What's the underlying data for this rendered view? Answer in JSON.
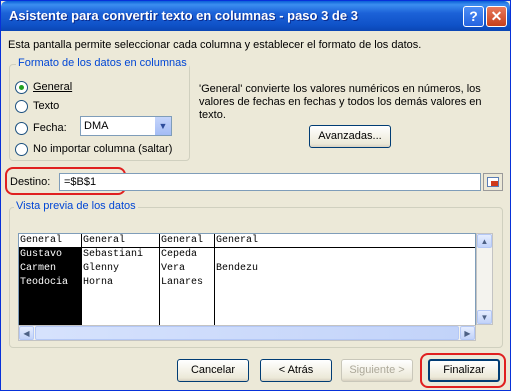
{
  "window": {
    "title": "Asistente para convertir texto en columnas - paso 3 de 3",
    "help_label": "?",
    "close_label": "✕"
  },
  "description": "Esta pantalla permite seleccionar cada columna y establecer el formato de los datos.",
  "format_group": {
    "legend": "Formato de los datos en columnas",
    "options": [
      {
        "label": "General",
        "checked": true
      },
      {
        "label": "Texto",
        "checked": false
      },
      {
        "label": "Fecha:",
        "checked": false
      },
      {
        "label": "No importar columna (saltar)",
        "checked": false
      }
    ],
    "date_select": {
      "value": "DMA"
    }
  },
  "info_text": "'General' convierte los valores numéricos en números, los valores de fechas en fechas y todos los demás valores en texto.",
  "advanced_button": "Avanzadas...",
  "destination": {
    "label": "Destino:",
    "value": "=$B$1"
  },
  "preview": {
    "legend": "Vista previa de los datos",
    "columns": [
      {
        "header": "General",
        "cells": [
          "Gustavo",
          "Carmen",
          "Teodocia"
        ],
        "selected": true
      },
      {
        "header": "General",
        "cells": [
          "Sebastiani",
          "Glenny",
          "Horna"
        ],
        "selected": false
      },
      {
        "header": "General",
        "cells": [
          "Cepeda",
          "Vera",
          "Lanares"
        ],
        "selected": false
      },
      {
        "header": "General",
        "cells": [
          "",
          "Bendezu",
          ""
        ],
        "selected": false
      }
    ]
  },
  "buttons": {
    "cancel": "Cancelar",
    "back": "< Atrás",
    "next": "Siguiente >",
    "finish": "Finalizar"
  },
  "colors": {
    "titlebar": "#0a5fd8",
    "highlight": "#e02020",
    "legend": "#0046d5"
  },
  "icons": [
    "help-icon",
    "close-icon",
    "chevron-down-icon",
    "range-selector-icon"
  ]
}
